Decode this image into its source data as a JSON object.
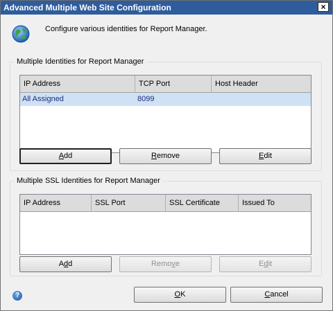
{
  "window": {
    "title": "Advanced Multiple Web Site Configuration",
    "close_label": "×"
  },
  "header": {
    "description": "Configure various identities for Report Manager."
  },
  "identities": {
    "legend": "Multiple Identities for Report Manager",
    "columns": [
      "IP Address",
      "TCP Port",
      "Host Header"
    ],
    "rows": [
      {
        "ip": "All Assigned",
        "port": "8099",
        "host": ""
      }
    ],
    "buttons": {
      "add": {
        "pre": "",
        "key": "A",
        "post": "dd"
      },
      "remove": {
        "pre": "",
        "key": "R",
        "post": "emove"
      },
      "edit": {
        "pre": "",
        "key": "E",
        "post": "dit"
      }
    }
  },
  "ssl": {
    "legend": "Multiple SSL Identities for Report Manager",
    "columns": [
      "IP Address",
      "SSL Port",
      "SSL Certificate",
      "Issued To"
    ],
    "buttons": {
      "add": {
        "pre": "A",
        "key": "d",
        "post": "d"
      },
      "remove": {
        "pre": "Remo",
        "key": "v",
        "post": "e"
      },
      "edit": {
        "pre": "E",
        "key": "d",
        "post": "it"
      }
    }
  },
  "footer": {
    "ok": {
      "pre": "",
      "key": "O",
      "post": "K"
    },
    "cancel": {
      "pre": "",
      "key": "C",
      "post": "ancel"
    },
    "help_glyph": "?"
  },
  "colors": {
    "title_bar": "#2f5c9c",
    "selected_row": "#cfe2f5",
    "selected_text": "#1a2c7a"
  },
  "icons": {
    "header": "globe-icon",
    "help": "help-icon",
    "close": "close-icon"
  }
}
